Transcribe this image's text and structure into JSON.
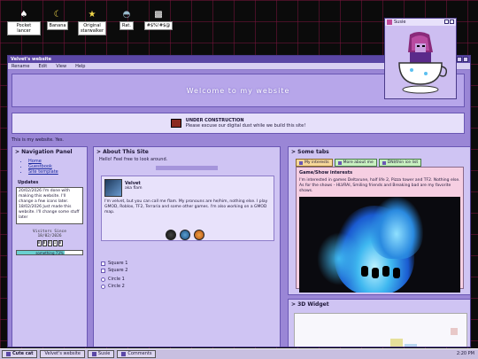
{
  "desktop": {
    "icons": [
      {
        "label": "Pocket lancer",
        "icon": "lancer-icon"
      },
      {
        "label": "Banana",
        "icon": "banana-icon"
      },
      {
        "label": "Original\nstarwalker",
        "icon": "starwalker-icon"
      },
      {
        "label": "Rat.",
        "icon": "rat-icon"
      },
      {
        "label": "#$%!#$@",
        "icon": "glitch-icon"
      }
    ]
  },
  "window": {
    "title": "Velvet's website",
    "menu": [
      "Rename",
      "Edit",
      "View",
      "Help"
    ]
  },
  "banner": {
    "text": "Welcome to my website"
  },
  "construction": {
    "title": "UNDER CONSTRUCTION",
    "text": "Please excuse our digital dust while we build this site!"
  },
  "tagline": "This is my website. Yes.",
  "nav": {
    "heading": "> Navigation Panel",
    "links": [
      "Home",
      "Guestbook",
      "Site template"
    ]
  },
  "updates": {
    "heading": "Updates",
    "text": "20/02/2026 I'm done with making this website. I'll change a few icons later. 18/02/2026 Just made this website. I'll change some stuff later"
  },
  "visitor": {
    "label": "Visitors Since",
    "date": "18/02/2026",
    "digits": [
      "0",
      "0",
      "4",
      "1",
      "0"
    ]
  },
  "progress": {
    "text": "something 73%",
    "value": 0.73
  },
  "about": {
    "heading": "> About This Site",
    "subtitle": "Hello! Feel free to look around.",
    "name": "Velvet",
    "aka": "aka flam",
    "bio": "I'm velvet, but you can call me flam. My pronouns are he/him, nothing else. I play GMOD, Roblox, TF2, Terraria and some other games. I'm also working on a GMOD map.",
    "checkboxes": [
      "Square 1",
      "Square 2"
    ],
    "radios": [
      "Circle 1",
      "Circle 2"
    ]
  },
  "tabs": {
    "heading": "> Some tabs",
    "items": [
      "My interests",
      "More about me",
      "DNI/thin ice list"
    ],
    "content_title": "Game/Show interests",
    "content_text": "I'm interested in games Deltarune, half life 2, Pizza tower and TF2. Nothing else. As for the shows - HLVRAI, Smiling friends and Breaking bad are my favorite shows."
  },
  "widget": {
    "heading": "> 3D Widget"
  },
  "popup": {
    "title": "Susie"
  },
  "taskbar": {
    "items": [
      "Cute cat",
      "Velvet's website",
      "Susie",
      "Comments"
    ],
    "time": "2:20 PM"
  }
}
